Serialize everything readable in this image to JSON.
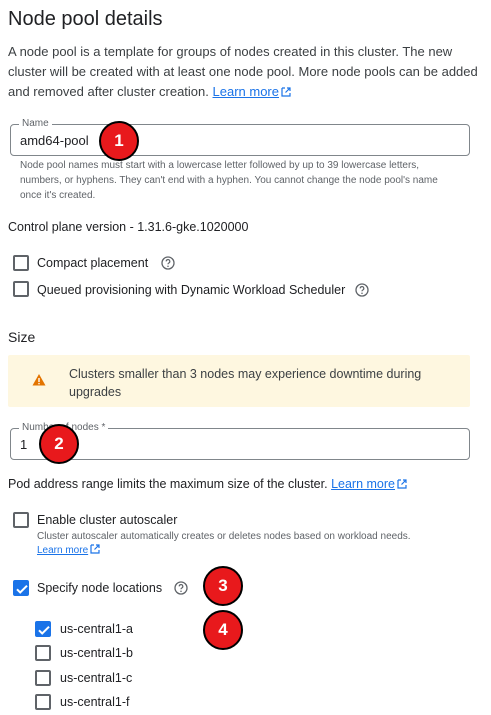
{
  "header": {
    "title": "Node pool details"
  },
  "intro": {
    "text": "A node pool is a template for groups of nodes created in this cluster. The new cluster will be created with at least one node pool. More node pools can be added and removed after cluster creation.",
    "learn_more": "Learn more"
  },
  "name_field": {
    "label": "Name",
    "value": "amd64-pool",
    "hint": "Node pool names must start with a lowercase letter followed by up to 39 lowercase letters, numbers, or hyphens. They can't end with a hyphen. You cannot change the node pool's name once it's created."
  },
  "control_plane": {
    "text": "Control plane version - 1.31.6-gke.1020000"
  },
  "options": {
    "compact_placement": {
      "label": "Compact placement",
      "checked": false
    },
    "queued_provisioning": {
      "label": "Queued provisioning with Dynamic Workload Scheduler",
      "checked": false
    }
  },
  "size": {
    "heading": "Size",
    "warning": "Clusters smaller than 3 nodes may experience downtime during upgrades",
    "nodes_label": "Number of nodes *",
    "nodes_value": "1",
    "pod_range_text": "Pod address range limits the maximum size of the cluster.",
    "pod_range_link": "Learn more"
  },
  "autoscaler": {
    "label": "Enable cluster autoscaler",
    "checked": false,
    "hint": "Cluster autoscaler automatically creates or deletes nodes based on workload needs.",
    "learn_more": "Learn more"
  },
  "locations": {
    "label": "Specify node locations",
    "checked": true,
    "zones": [
      {
        "name": "us-central1-a",
        "checked": true
      },
      {
        "name": "us-central1-b",
        "checked": false
      },
      {
        "name": "us-central1-c",
        "checked": false
      },
      {
        "name": "us-central1-f",
        "checked": false
      }
    ]
  },
  "badges": [
    "1",
    "2",
    "3",
    "4"
  ],
  "colors": {
    "accent": "#1a73e8",
    "badge": "#e8191c",
    "warning_bg": "#fef7e0",
    "warning_icon": "#e37400"
  },
  "icons": {
    "help": "help-icon",
    "external": "external-link-icon",
    "warning": "warning-icon",
    "check": "check-icon"
  }
}
